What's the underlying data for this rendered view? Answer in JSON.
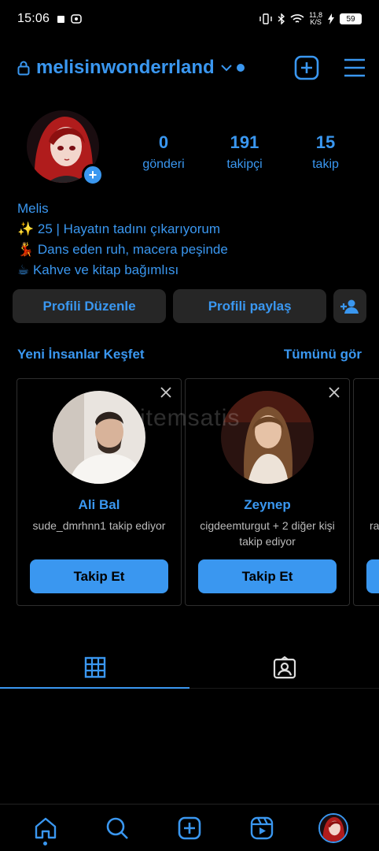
{
  "status_bar": {
    "time": "15:06",
    "net_speed_top": "11,8",
    "net_speed_bottom": "K/S",
    "battery": "59"
  },
  "top_bar": {
    "username": "melisinwonderrland"
  },
  "profile": {
    "stats": [
      {
        "value": "0",
        "label": "gönderi"
      },
      {
        "value": "191",
        "label": "takipçi"
      },
      {
        "value": "15",
        "label": "takip"
      }
    ],
    "name": "Melis",
    "bio": [
      "✨ 25 | Hayatın tadını çıkarıyorum",
      "💃 Dans eden ruh, macera peşinde",
      "☕ Kahve ve kitap bağımlısı"
    ]
  },
  "buttons": {
    "edit": "Profili Düzenle",
    "share": "Profili paylaş"
  },
  "discover": {
    "title": "Yeni İnsanlar Keşfet",
    "see_all": "Tümünü gör",
    "cards": [
      {
        "name": "Ali Bal",
        "sub": "sude_dmrhnn1 takip ediyor",
        "follow": "Takip Et"
      },
      {
        "name": "Zeynep",
        "sub": "cigdeemturgut + 2 diğer kişi takip ediyor",
        "follow": "Takip Et"
      },
      {
        "name": "",
        "sub": "ra",
        "follow": ""
      }
    ]
  },
  "watermark": "itemsatis",
  "colors": {
    "accent": "#3a97f0",
    "background": "#000000",
    "button_bg": "#262626"
  }
}
